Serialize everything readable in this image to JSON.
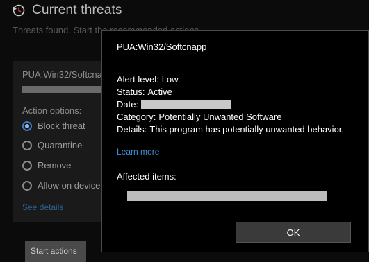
{
  "background": {
    "title": "Current threats",
    "subtitle": "Threats found. Start the recommended actions.",
    "threat_card": {
      "name": "PUA:Win32/Softcnapp",
      "action_options_label": "Action options:",
      "options": [
        {
          "label": "Block threat",
          "selected": true
        },
        {
          "label": "Quarantine",
          "selected": false
        },
        {
          "label": "Remove",
          "selected": false
        },
        {
          "label": "Allow on device",
          "selected": false
        }
      ],
      "see_details": "See details"
    },
    "start_actions_label": "Start actions"
  },
  "dialog": {
    "title": "PUA:Win32/Softcnapp",
    "alert_level_label": "Alert level:",
    "alert_level_value": "Low",
    "status_label": "Status:",
    "status_value": "Active",
    "date_label": "Date:",
    "category_label": "Category:",
    "category_value": "Potentially Unwanted Software",
    "details_label": "Details:",
    "details_value": "This program has potentially unwanted behavior.",
    "learn_more": "Learn more",
    "affected_items_label": "Affected items:",
    "ok_label": "OK"
  },
  "colors": {
    "accent": "#3a8fd8",
    "dialog_bg": "#000000",
    "radio_selected": "#3b7fc4",
    "redaction": "#c8c8c8"
  },
  "icons": {
    "header_icon": "shield-history-icon"
  }
}
